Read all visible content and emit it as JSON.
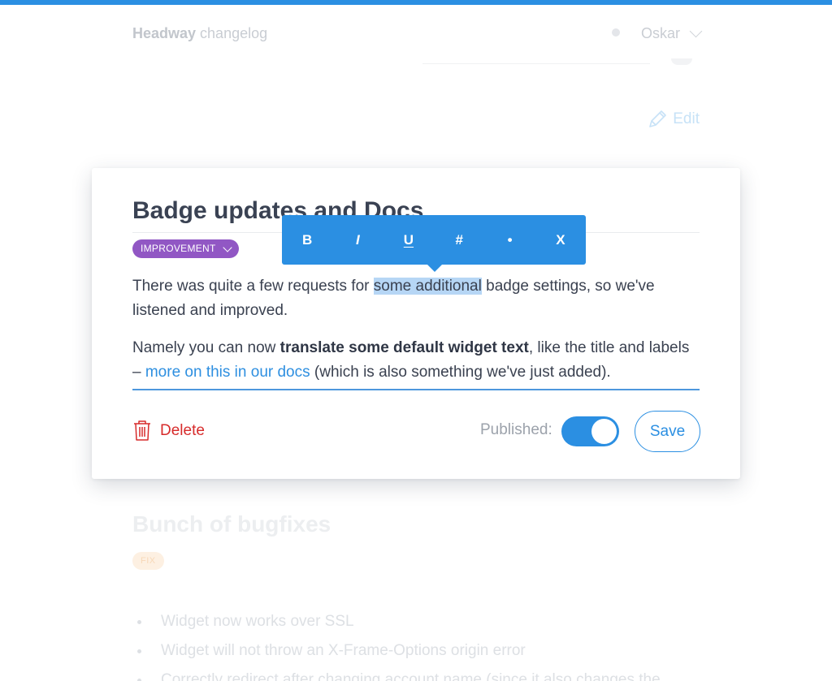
{
  "header": {
    "brand_strong": "Headway",
    "brand_rest": " changelog",
    "user_name": "Oskar",
    "edit_label": "Edit"
  },
  "editor": {
    "title": "Badge updates and Docs",
    "category": "IMPROVEMENT",
    "paragraph1": {
      "before": "There was quite a few requests for ",
      "selected": "some additional",
      "after": " badge settings, so we've listened and improved."
    },
    "paragraph2": {
      "before": "Namely you can now ",
      "bold": "translate some default widget text",
      "middle": ", like the title and labels – ",
      "link": "more on this in our docs",
      "after": " (which is also something we've just added)."
    },
    "delete_label": "Delete",
    "published_label": "Published:",
    "published": true,
    "save_label": "Save"
  },
  "toolbar": {
    "bold": "B",
    "italic": "I",
    "underline": "U",
    "heading": "#",
    "bullet": "•",
    "close": "X"
  },
  "next_post": {
    "title": "Bunch of bugfixes",
    "category": "FIX",
    "items": [
      "Widget now works over SSL",
      "Widget will not throw an X-Frame-Options origin error",
      "Correctly redirect after changing account name (since it also changes the"
    ]
  },
  "colors": {
    "accent": "#2b8fe2",
    "improvement_badge": "#9157c4",
    "delete": "#d72b2b",
    "selection": "#b6d6f5"
  }
}
